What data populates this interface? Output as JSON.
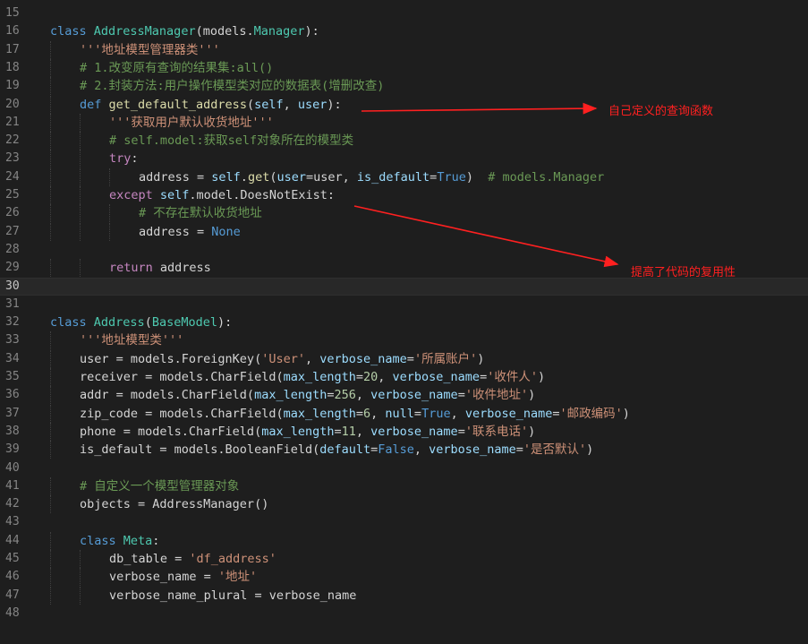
{
  "colors": {
    "background": "#1e1e1e",
    "keyword": "#569cd6",
    "class_name": "#4ec9b0",
    "function": "#dcdcaa",
    "string": "#ce9178",
    "comment": "#6a9955",
    "parameter": "#9cdcfe",
    "number": "#b5cea8",
    "annotation": "#ff2020"
  },
  "editor": {
    "active_line": 30,
    "lines": [
      {
        "n": "15",
        "indent": 0,
        "tokens": []
      },
      {
        "n": "16",
        "indent": 0,
        "tokens": [
          [
            "kw",
            "class "
          ],
          [
            "cls",
            "AddressManager"
          ],
          [
            "plain",
            "(models."
          ],
          [
            "cls",
            "Manager"
          ],
          [
            "plain",
            "):"
          ]
        ]
      },
      {
        "n": "17",
        "indent": 1,
        "tokens": [
          [
            "str",
            "'''地址模型管理器类'''"
          ]
        ]
      },
      {
        "n": "18",
        "indent": 1,
        "tokens": [
          [
            "cmt",
            "# 1.改变原有查询的结果集:all()"
          ]
        ]
      },
      {
        "n": "19",
        "indent": 1,
        "tokens": [
          [
            "cmt",
            "# 2.封装方法:用户操作模型类对应的数据表(增删改查)"
          ]
        ]
      },
      {
        "n": "20",
        "indent": 1,
        "tokens": [
          [
            "kw",
            "def "
          ],
          [
            "fn",
            "get_default_address"
          ],
          [
            "plain",
            "("
          ],
          [
            "param",
            "self"
          ],
          [
            "plain",
            ", "
          ],
          [
            "param",
            "user"
          ],
          [
            "plain",
            "):"
          ]
        ]
      },
      {
        "n": "21",
        "indent": 2,
        "tokens": [
          [
            "str",
            "'''获取用户默认收货地址'''"
          ]
        ]
      },
      {
        "n": "22",
        "indent": 2,
        "tokens": [
          [
            "cmt",
            "# self.model:获取self对象所在的模型类"
          ]
        ]
      },
      {
        "n": "23",
        "indent": 2,
        "tokens": [
          [
            "ctrl",
            "try"
          ],
          [
            "plain",
            ":"
          ]
        ]
      },
      {
        "n": "24",
        "indent": 3,
        "tokens": [
          [
            "plain",
            "address = "
          ],
          [
            "param",
            "self"
          ],
          [
            "plain",
            "."
          ],
          [
            "fn",
            "get"
          ],
          [
            "plain",
            "("
          ],
          [
            "param",
            "user"
          ],
          [
            "plain",
            "=user, "
          ],
          [
            "param",
            "is_default"
          ],
          [
            "plain",
            "="
          ],
          [
            "kw",
            "True"
          ],
          [
            "plain",
            ")  "
          ],
          [
            "cmt",
            "# models.Manager"
          ]
        ]
      },
      {
        "n": "25",
        "indent": 2,
        "tokens": [
          [
            "ctrl",
            "except "
          ],
          [
            "param",
            "self"
          ],
          [
            "plain",
            ".model.DoesNotExist:"
          ]
        ]
      },
      {
        "n": "26",
        "indent": 3,
        "tokens": [
          [
            "cmt",
            "# 不存在默认收货地址"
          ]
        ]
      },
      {
        "n": "27",
        "indent": 3,
        "tokens": [
          [
            "plain",
            "address = "
          ],
          [
            "kw",
            "None"
          ]
        ]
      },
      {
        "n": "28",
        "indent": 0,
        "tokens": []
      },
      {
        "n": "29",
        "indent": 2,
        "tokens": [
          [
            "ctrl",
            "return "
          ],
          [
            "plain",
            "address"
          ]
        ]
      },
      {
        "n": "30",
        "indent": 0,
        "tokens": []
      },
      {
        "n": "31",
        "indent": 0,
        "tokens": []
      },
      {
        "n": "32",
        "indent": 0,
        "tokens": [
          [
            "kw",
            "class "
          ],
          [
            "cls",
            "Address"
          ],
          [
            "plain",
            "("
          ],
          [
            "cls",
            "BaseModel"
          ],
          [
            "plain",
            "):"
          ]
        ]
      },
      {
        "n": "33",
        "indent": 1,
        "tokens": [
          [
            "str",
            "'''地址模型类'''"
          ]
        ]
      },
      {
        "n": "34",
        "indent": 1,
        "tokens": [
          [
            "plain",
            "user = models.ForeignKey("
          ],
          [
            "str",
            "'User'"
          ],
          [
            "plain",
            ", "
          ],
          [
            "param",
            "verbose_name"
          ],
          [
            "plain",
            "="
          ],
          [
            "str",
            "'所属账户'"
          ],
          [
            "plain",
            ")"
          ]
        ]
      },
      {
        "n": "35",
        "indent": 1,
        "tokens": [
          [
            "plain",
            "receiver = models.CharField("
          ],
          [
            "param",
            "max_length"
          ],
          [
            "plain",
            "="
          ],
          [
            "num",
            "20"
          ],
          [
            "plain",
            ", "
          ],
          [
            "param",
            "verbose_name"
          ],
          [
            "plain",
            "="
          ],
          [
            "str",
            "'收件人'"
          ],
          [
            "plain",
            ")"
          ]
        ]
      },
      {
        "n": "36",
        "indent": 1,
        "tokens": [
          [
            "plain",
            "addr = models.CharField("
          ],
          [
            "param",
            "max_length"
          ],
          [
            "plain",
            "="
          ],
          [
            "num",
            "256"
          ],
          [
            "plain",
            ", "
          ],
          [
            "param",
            "verbose_name"
          ],
          [
            "plain",
            "="
          ],
          [
            "str",
            "'收件地址'"
          ],
          [
            "plain",
            ")"
          ]
        ]
      },
      {
        "n": "37",
        "indent": 1,
        "tokens": [
          [
            "plain",
            "zip_code = models.CharField("
          ],
          [
            "param",
            "max_length"
          ],
          [
            "plain",
            "="
          ],
          [
            "num",
            "6"
          ],
          [
            "plain",
            ", "
          ],
          [
            "param",
            "null"
          ],
          [
            "plain",
            "="
          ],
          [
            "kw",
            "True"
          ],
          [
            "plain",
            ", "
          ],
          [
            "param",
            "verbose_name"
          ],
          [
            "plain",
            "="
          ],
          [
            "str",
            "'邮政编码'"
          ],
          [
            "plain",
            ")"
          ]
        ]
      },
      {
        "n": "38",
        "indent": 1,
        "tokens": [
          [
            "plain",
            "phone = models.CharField("
          ],
          [
            "param",
            "max_length"
          ],
          [
            "plain",
            "="
          ],
          [
            "num",
            "11"
          ],
          [
            "plain",
            ", "
          ],
          [
            "param",
            "verbose_name"
          ],
          [
            "plain",
            "="
          ],
          [
            "str",
            "'联系电话'"
          ],
          [
            "plain",
            ")"
          ]
        ]
      },
      {
        "n": "39",
        "indent": 1,
        "tokens": [
          [
            "plain",
            "is_default = models.BooleanField("
          ],
          [
            "param",
            "default"
          ],
          [
            "plain",
            "="
          ],
          [
            "kw",
            "False"
          ],
          [
            "plain",
            ", "
          ],
          [
            "param",
            "verbose_name"
          ],
          [
            "plain",
            "="
          ],
          [
            "str",
            "'是否默认'"
          ],
          [
            "plain",
            ")"
          ]
        ]
      },
      {
        "n": "40",
        "indent": 0,
        "tokens": []
      },
      {
        "n": "41",
        "indent": 1,
        "tokens": [
          [
            "cmt",
            "# 自定义一个模型管理器对象"
          ]
        ]
      },
      {
        "n": "42",
        "indent": 1,
        "tokens": [
          [
            "plain",
            "objects = AddressManager()"
          ]
        ]
      },
      {
        "n": "43",
        "indent": 0,
        "tokens": []
      },
      {
        "n": "44",
        "indent": 1,
        "tokens": [
          [
            "kw",
            "class "
          ],
          [
            "cls",
            "Meta"
          ],
          [
            "plain",
            ":"
          ]
        ]
      },
      {
        "n": "45",
        "indent": 2,
        "tokens": [
          [
            "plain",
            "db_table = "
          ],
          [
            "str",
            "'df_address'"
          ]
        ]
      },
      {
        "n": "46",
        "indent": 2,
        "tokens": [
          [
            "plain",
            "verbose_name = "
          ],
          [
            "str",
            "'地址'"
          ]
        ]
      },
      {
        "n": "47",
        "indent": 2,
        "tokens": [
          [
            "plain",
            "verbose_name_plural = verbose_name"
          ]
        ]
      },
      {
        "n": "48",
        "indent": 0,
        "tokens": []
      }
    ]
  },
  "annotations": {
    "self_defined_query": "自己定义的查询函数",
    "reusability": "提高了代码的复用性"
  }
}
